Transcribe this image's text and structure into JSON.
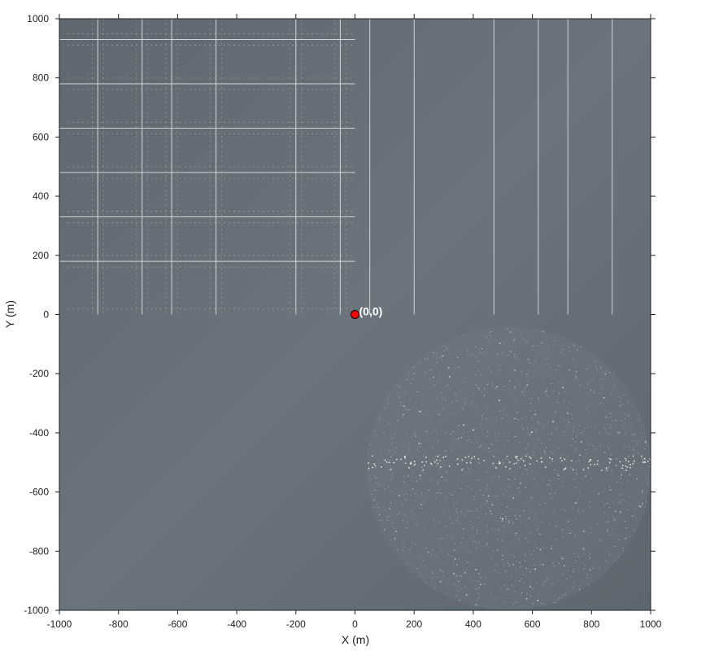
{
  "chart_data": {
    "type": "scatter",
    "xlabel": "X (m)",
    "ylabel": "Y (m)",
    "xlim": [
      -1000,
      1000
    ],
    "ylim": [
      -1000,
      1000
    ],
    "xticks": [
      "-1000",
      "-800",
      "-600",
      "-400",
      "-200",
      "0",
      "200",
      "400",
      "600",
      "800",
      "1000"
    ],
    "yticks": [
      "1000",
      "800",
      "600",
      "400",
      "200",
      "0",
      "-200",
      "-400",
      "-600",
      "-800",
      "-1000"
    ],
    "grid": false,
    "background_color": "#6a737d",
    "grid_region_lines": {
      "region": {
        "x": [
          -1000,
          0
        ],
        "y": [
          0,
          1000
        ]
      },
      "vertical_x": [
        -870,
        -720,
        -620,
        -470,
        -200,
        -50
      ],
      "horizontal_y": [
        930,
        780,
        630,
        480,
        330,
        180
      ]
    },
    "upper_right_lines": {
      "region": {
        "x": [
          0,
          1000
        ],
        "y": [
          0,
          1000
        ]
      },
      "vertical_x": [
        50,
        200,
        470,
        620,
        720,
        870
      ]
    },
    "speckle_region": {
      "center": [
        520,
        -520
      ],
      "radius": 480
    },
    "points": [
      {
        "x": 0,
        "y": 0,
        "label": "(0,0)",
        "color": "#ff0000"
      }
    ]
  }
}
